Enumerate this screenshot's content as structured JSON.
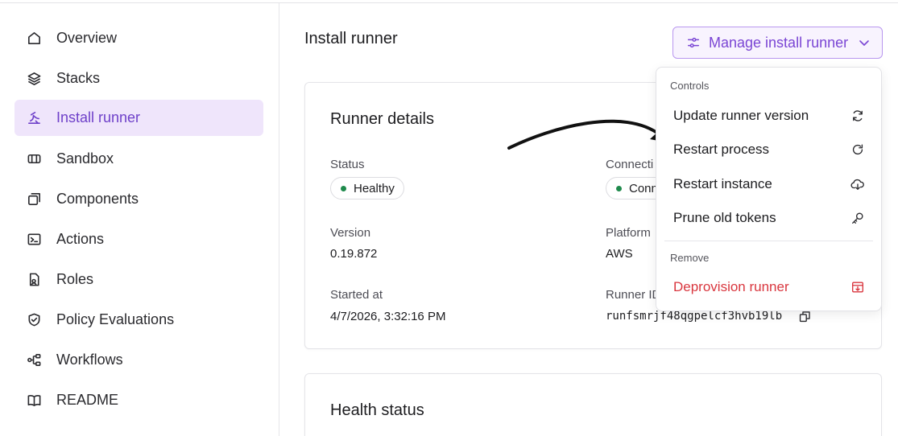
{
  "sidebar": {
    "items": [
      {
        "label": "Overview",
        "icon": "home-icon"
      },
      {
        "label": "Stacks",
        "icon": "layers-icon"
      },
      {
        "label": "Install runner",
        "icon": "runner-icon",
        "active": true
      },
      {
        "label": "Sandbox",
        "icon": "sandbox-icon"
      },
      {
        "label": "Components",
        "icon": "components-icon"
      },
      {
        "label": "Actions",
        "icon": "terminal-icon"
      },
      {
        "label": "Roles",
        "icon": "roles-icon"
      },
      {
        "label": "Policy Evaluations",
        "icon": "shield-check-icon"
      },
      {
        "label": "Workflows",
        "icon": "workflow-icon"
      },
      {
        "label": "README",
        "icon": "book-icon"
      }
    ]
  },
  "header": {
    "title": "Install runner",
    "manage_label": "Manage install runner"
  },
  "details": {
    "title": "Runner details",
    "status_label": "Status",
    "status_value": "Healthy",
    "connection_label": "Connecti",
    "connection_value": "Conn",
    "version_label": "Version",
    "version_value": "0.19.872",
    "platform_label": "Platform",
    "platform_value": "AWS",
    "started_label": "Started at",
    "started_value": "4/7/2026, 3:32:16 PM",
    "runner_id_label": "Runner ID",
    "runner_id_value": "runfsmrjf48qgpelcf3hvb19lb"
  },
  "health": {
    "title": "Health status"
  },
  "menu": {
    "controls_label": "Controls",
    "items": [
      {
        "label": "Update runner version",
        "icon": "refresh-icon"
      },
      {
        "label": "Restart process",
        "icon": "rotate-cw-icon"
      },
      {
        "label": "Restart instance",
        "icon": "cloud-download-icon"
      },
      {
        "label": "Prune old tokens",
        "icon": "key-icon"
      }
    ],
    "remove_label": "Remove",
    "danger_item": {
      "label": "Deprovision runner",
      "icon": "archive-x-icon"
    }
  },
  "colors": {
    "accent": "#7a45d4",
    "active_bg": "#efe5fb",
    "healthy": "#1f8a4c",
    "danger": "#d9363e"
  }
}
